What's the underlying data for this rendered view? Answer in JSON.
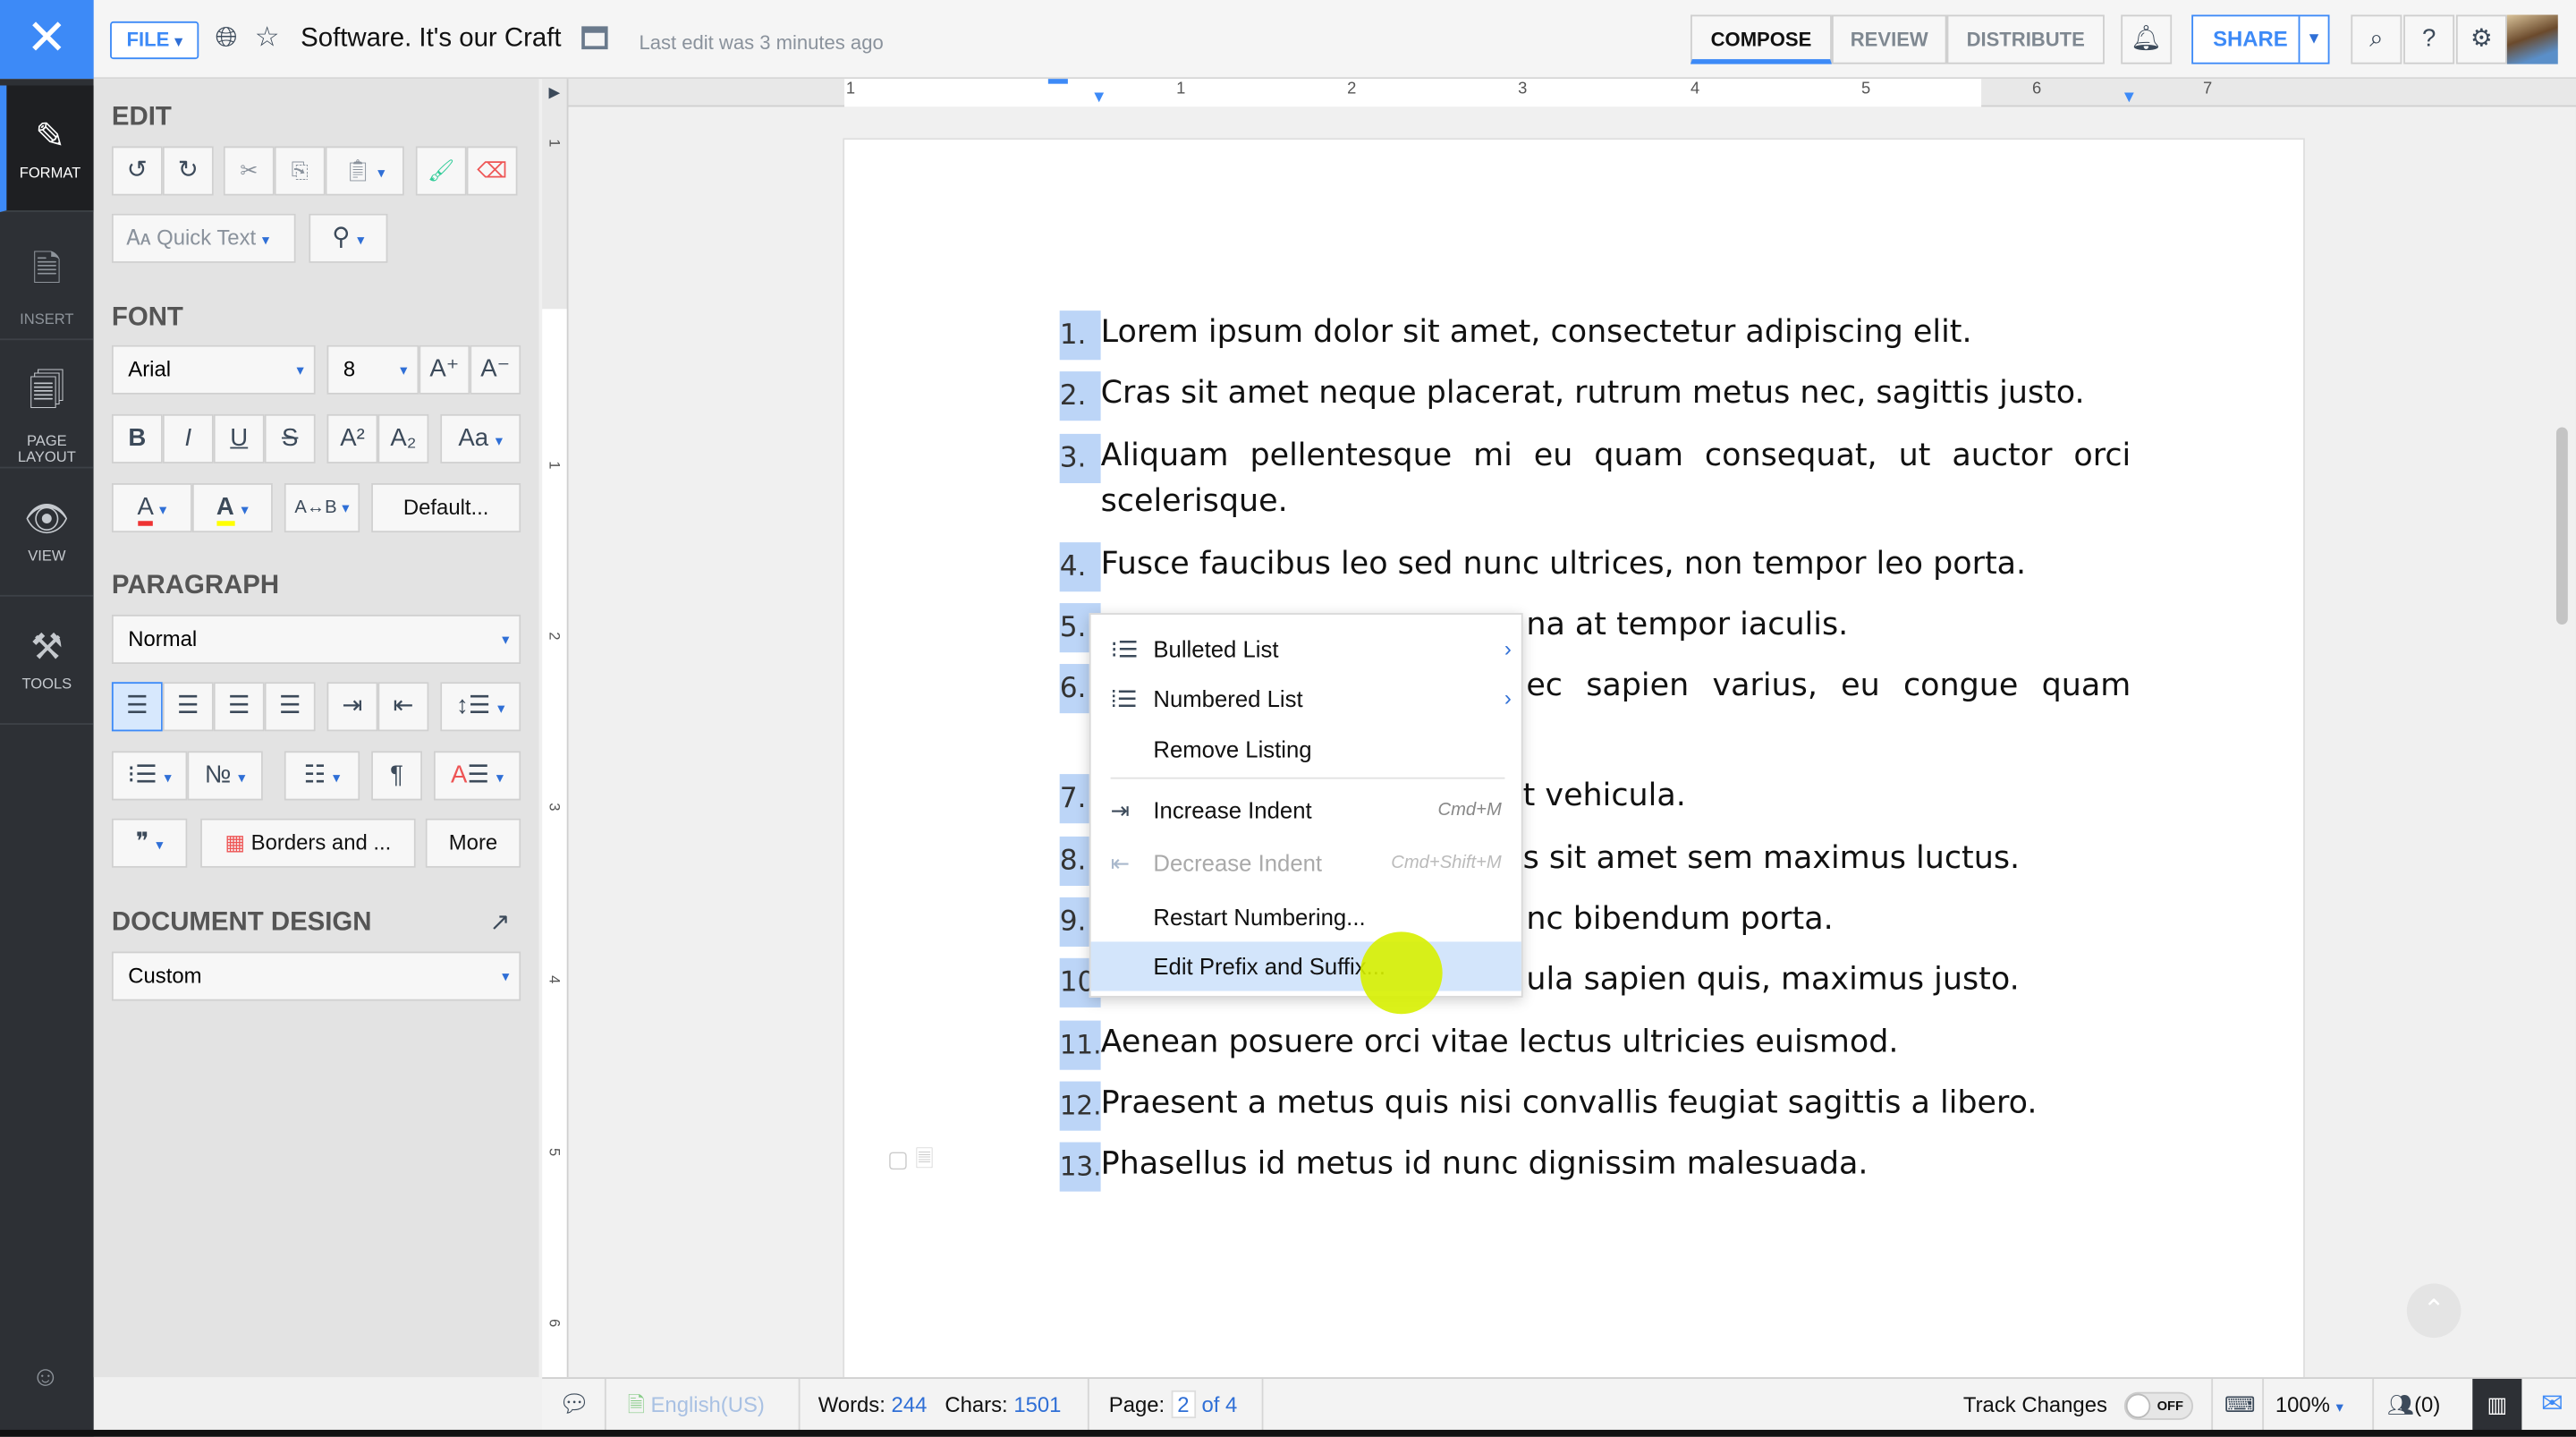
{
  "topbar": {
    "file_label": "FILE",
    "title": "Software. It's our Craft",
    "last_edit": "Last edit was 3 minutes ago",
    "modes": [
      "COMPOSE",
      "REVIEW",
      "DISTRIBUTE"
    ],
    "active_mode": "COMPOSE",
    "share_label": "SHARE"
  },
  "leftnav": {
    "items": [
      {
        "label": "FORMAT"
      },
      {
        "label": "INSERT"
      },
      {
        "label": "PAGE LAYOUT"
      },
      {
        "label": "VIEW"
      },
      {
        "label": "TOOLS"
      }
    ],
    "active": "FORMAT"
  },
  "panel": {
    "edit": {
      "heading": "EDIT",
      "quick_text": "Quick Text"
    },
    "font": {
      "heading": "FONT",
      "family": "Arial",
      "size": "8",
      "default_label": "Default..."
    },
    "paragraph": {
      "heading": "PARAGRAPH",
      "style": "Normal",
      "borders_label": "Borders and ...",
      "more_label": "More"
    },
    "design": {
      "heading": "DOCUMENT DESIGN",
      "value": "Custom"
    }
  },
  "ruler": {
    "h": [
      "1",
      "1",
      "2",
      "3",
      "4",
      "5",
      "6",
      "7"
    ],
    "v": [
      "1",
      "1",
      "2",
      "3",
      "4",
      "5",
      "6"
    ]
  },
  "document": {
    "lines": [
      {
        "n": "1.",
        "text": "Lorem ipsum dolor sit amet, consectetur adipiscing elit."
      },
      {
        "n": "2.",
        "text": "Cras sit amet neque placerat, rutrum metus nec, sagittis justo."
      },
      {
        "n": "3.",
        "text": "Aliquam pellentesque mi eu quam consequat, ut auctor orci",
        "cont": "scelerisque."
      },
      {
        "n": "4.",
        "text": "Fusce faucibus leo sed nunc ultrices, non tempor leo porta."
      },
      {
        "n": "5.",
        "text": "na at tempor iaculis."
      },
      {
        "n": "6.",
        "text": "ec sapien varius, eu congue quam"
      },
      {
        "n": "7.",
        "text": "t vehicula."
      },
      {
        "n": "8.",
        "text": "s sit amet sem maximus luctus."
      },
      {
        "n": "9.",
        "text": "nc bibendum porta."
      },
      {
        "n": "10",
        "text": "ula sapien quis, maximus justo."
      },
      {
        "n": "11.",
        "text": "Aenean posuere orci vitae lectus ultricies euismod."
      },
      {
        "n": "12.",
        "text": "Praesent a metus quis nisi convallis feugiat sagittis a libero."
      },
      {
        "n": "13.",
        "text": "Phasellus id metus id nunc dignissim malesuada."
      }
    ]
  },
  "context_menu": {
    "items": [
      {
        "label": "Bulleted List",
        "submenu": true
      },
      {
        "label": "Numbered List",
        "submenu": true
      },
      {
        "label": "Remove Listing"
      },
      {
        "label": "Increase Indent",
        "shortcut": "Cmd+M"
      },
      {
        "label": "Decrease Indent",
        "shortcut": "Cmd+Shift+M",
        "disabled": true
      },
      {
        "label": "Restart Numbering..."
      },
      {
        "label": "Edit Prefix and Suffix...",
        "highlighted": true
      }
    ]
  },
  "status": {
    "language": "English(US)",
    "words_label": "Words:",
    "words": "244",
    "chars_label": "Chars:",
    "chars": "1501",
    "page_label": "Page:",
    "page": "2",
    "page_total": "of 4",
    "track_changes": "Track Changes",
    "toggle": "OFF",
    "zoom": "100%",
    "collaborators": "(0)"
  },
  "colors": {
    "accent": "#3d8af7",
    "nav_bg": "#2d3035",
    "panel_bg": "#e3e3e3",
    "list_highlight": "#bcd5f7"
  }
}
